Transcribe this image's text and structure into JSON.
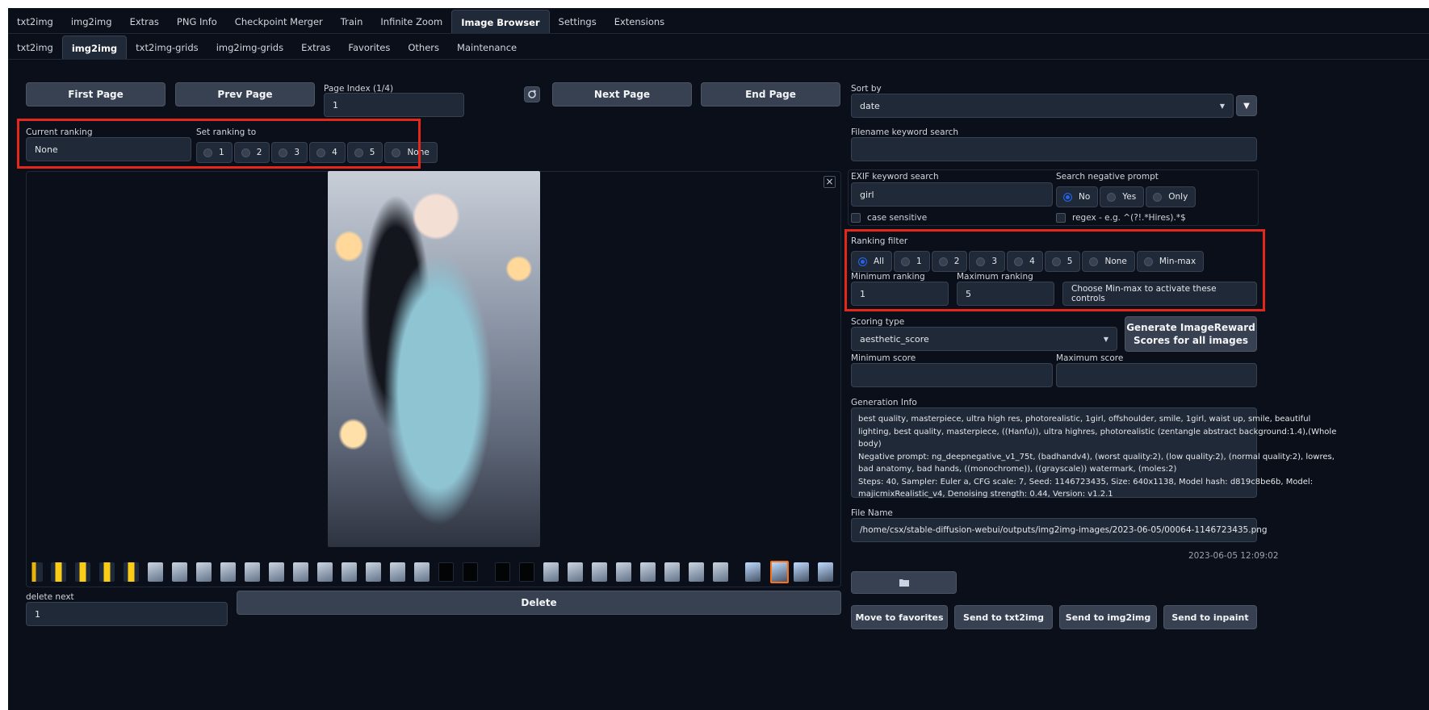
{
  "top_tabs": [
    "txt2img",
    "img2img",
    "Extras",
    "PNG Info",
    "Checkpoint Merger",
    "Train",
    "Infinite Zoom",
    "Image Browser",
    "Settings",
    "Extensions"
  ],
  "top_tabs_active_index": 7,
  "sub_tabs": [
    "txt2img",
    "img2img",
    "txt2img-grids",
    "img2img-grids",
    "Extras",
    "Favorites",
    "Others",
    "Maintenance"
  ],
  "sub_tabs_active_index": 1,
  "nav": {
    "first_page": "First Page",
    "prev_page": "Prev Page",
    "page_index_label": "Page Index (1/4)",
    "page_index_value": "1",
    "next_page": "Next Page",
    "end_page": "End Page"
  },
  "ranking": {
    "current_label": "Current ranking",
    "current_value": "None",
    "set_label": "Set ranking to",
    "options": [
      "1",
      "2",
      "3",
      "4",
      "5",
      "None"
    ]
  },
  "sort": {
    "label": "Sort by",
    "value": "date"
  },
  "filename_search": {
    "label": "Filename keyword search",
    "value": ""
  },
  "exif": {
    "label": "EXIF keyword search",
    "value": "girl",
    "case_sensitive_label": "case sensitive",
    "regex_label": "regex - e.g. ^(?!.*Hires).*$"
  },
  "negative_prompt": {
    "label": "Search negative prompt",
    "options": [
      "No",
      "Yes",
      "Only"
    ],
    "selected": "No"
  },
  "ranking_filter": {
    "label": "Ranking filter",
    "options": [
      "All",
      "1",
      "2",
      "3",
      "4",
      "5",
      "None",
      "Min-max"
    ],
    "selected": "All",
    "min_label": "Minimum ranking",
    "min_value": "1",
    "max_label": "Maximum ranking",
    "max_value": "5",
    "hint": "Choose Min-max to activate these controls"
  },
  "scoring": {
    "type_label": "Scoring type",
    "type_value": "aesthetic_score",
    "generate_line1": "Generate ImageReward",
    "generate_line2": "Scores for all images",
    "min_label": "Minimum score",
    "max_label": "Maximum score"
  },
  "generation_info": {
    "label": "Generation Info",
    "line1": "best quality, masterpiece, ultra high res, photorealistic, 1girl, offshoulder, smile, 1girl, waist up, smile, beautiful",
    "line2": "lighting, best quality, masterpiece, ((Hanfu)), ultra highres, photorealistic (zentangle abstract background:1.4),(Whole",
    "line3": "body)",
    "line4": "Negative prompt: ng_deepnegative_v1_75t, (badhandv4), (worst quality:2), (low quality:2), (normal quality:2), lowres,",
    "line5": "bad anatomy, bad hands, ((monochrome)), ((grayscale)) watermark, (moles:2)",
    "line6": "Steps: 40, Sampler: Euler a, CFG scale: 7, Seed: 1146723435, Size: 640x1138, Model hash: d819c8be6b, Model:",
    "line7": "majicmixRealistic_v4, Denoising strength: 0.44, Version: v1.2.1"
  },
  "file": {
    "label": "File Name",
    "value": "/home/csx/stable-diffusion-webui/outputs/img2img-images/2023-06-05/00064-1146723435.png",
    "timestamp": "2023-06-05 12:09:02"
  },
  "bottom": {
    "delete_next_label": "delete next",
    "delete_next_value": "1",
    "delete": "Delete",
    "move_to_favorites": "Move to favorites",
    "send_txt2img": "Send to txt2img",
    "send_img2img": "Send to img2img",
    "send_inpaint": "Send to inpaint"
  },
  "gallery_close": "×",
  "icons": [
    "refresh-icon",
    "dropdown-arrow-icon",
    "filter-icon",
    "close-icon",
    "folder-icon"
  ],
  "colors": {
    "background": "#0b0f19",
    "panel": "#1f2937",
    "button": "#374151",
    "accent": "#2563eb",
    "highlight": "#e3281b",
    "selected_thumb": "#f97316"
  }
}
